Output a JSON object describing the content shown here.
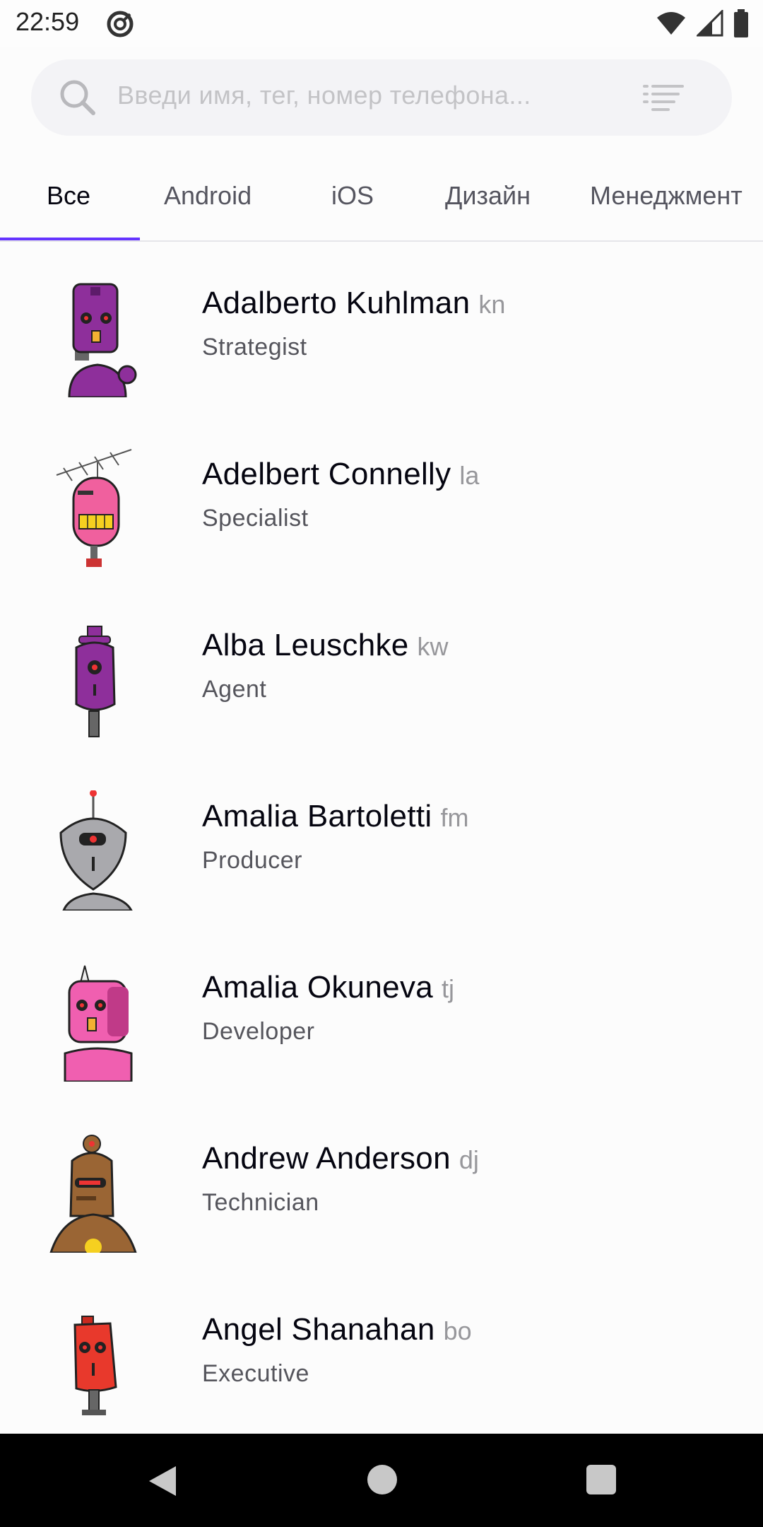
{
  "status_bar": {
    "time": "22:59",
    "dnd_icon": "do-not-disturb-icon",
    "wifi_icon": "wifi-icon",
    "signal_icon": "cell-signal-icon",
    "battery_icon": "battery-icon"
  },
  "search": {
    "placeholder": "Введи имя, тег, номер телефона...",
    "value": "",
    "search_icon": "search-icon",
    "filter_icon": "filter-sort-icon"
  },
  "tabs": [
    {
      "label": "Все",
      "active": true
    },
    {
      "label": "Android",
      "active": false
    },
    {
      "label": "iOS",
      "active": false
    },
    {
      "label": "Дизайн",
      "active": false
    },
    {
      "label": "Менеджмент",
      "active": false
    }
  ],
  "accent_color": "#6534ff",
  "contacts": [
    {
      "name": "Adalberto Kuhlman",
      "tag": "kn",
      "role": "Strategist",
      "avatar_color": "#8e2f9b"
    },
    {
      "name": "Adelbert Connelly",
      "tag": "la",
      "role": "Specialist",
      "avatar_color": "#f0609e"
    },
    {
      "name": "Alba Leuschke",
      "tag": "kw",
      "role": "Agent",
      "avatar_color": "#8e2f9b"
    },
    {
      "name": "Amalia Bartoletti",
      "tag": "fm",
      "role": "Producer",
      "avatar_color": "#a9a9ad"
    },
    {
      "name": "Amalia Okuneva",
      "tag": "tj",
      "role": "Developer",
      "avatar_color": "#f05fb0"
    },
    {
      "name": "Andrew Anderson",
      "tag": "dj",
      "role": "Technician",
      "avatar_color": "#9a6534"
    },
    {
      "name": "Angel Shanahan",
      "tag": "bo",
      "role": "Executive",
      "avatar_color": "#e8392c"
    }
  ],
  "nav_bar": {
    "back_icon": "back-triangle-icon",
    "home_icon": "home-circle-icon",
    "recents_icon": "recents-square-icon"
  }
}
